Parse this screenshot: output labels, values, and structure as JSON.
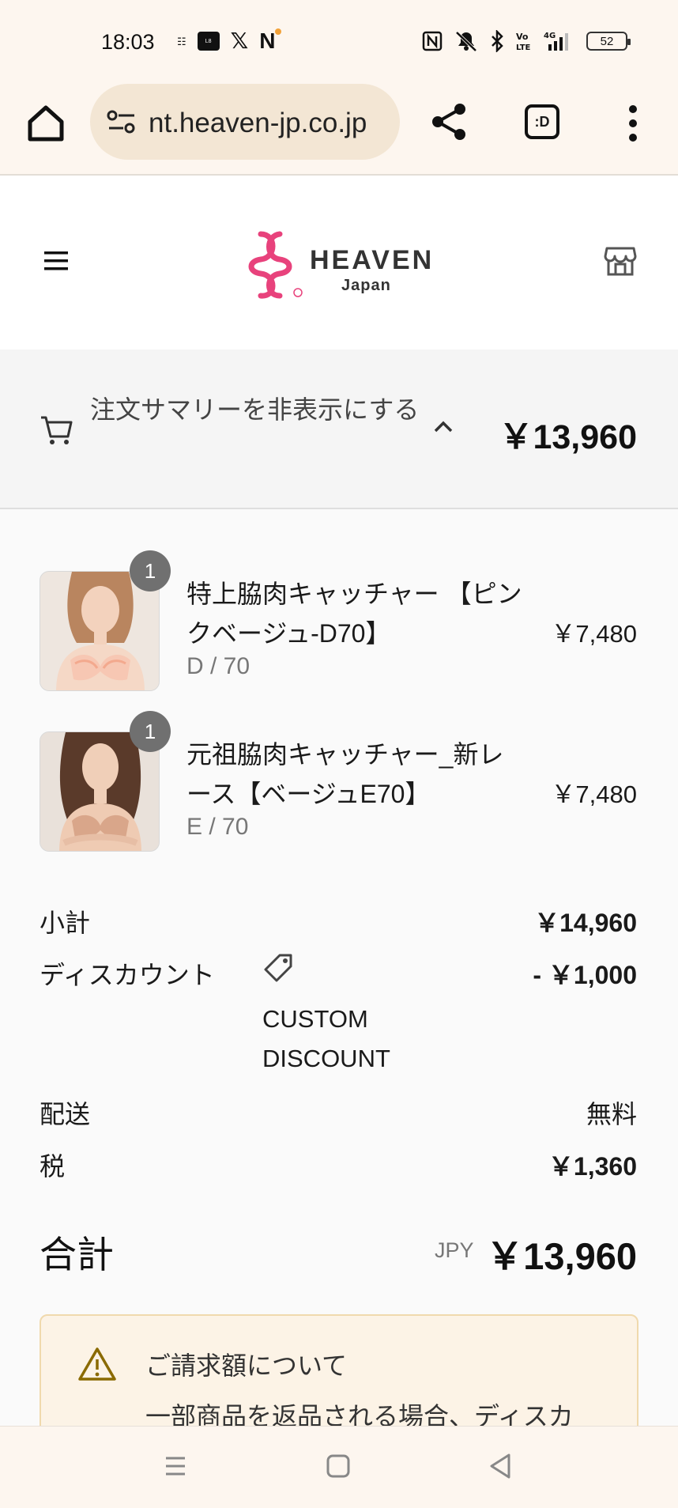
{
  "status_bar": {
    "time": "18:03",
    "left_icons": [
      "temu-icon",
      "lemon8-icon",
      "x-icon",
      "n-icon"
    ],
    "right_icons": [
      "nfc-icon",
      "mute-icon",
      "bluetooth-icon",
      "volte-icon",
      "signal-4g-icon"
    ],
    "battery": "52"
  },
  "browser": {
    "url": "nt.heaven-jp.co.jp",
    "tabs_label": ":D"
  },
  "site": {
    "brand": "HEAVEN",
    "brand_sub": "Japan",
    "brand_color": "#e8427c"
  },
  "summary_bar": {
    "toggle_label": "注文サマリーを非表示にする",
    "total": "￥13,960"
  },
  "items": [
    {
      "quantity": "1",
      "name": "特上脇肉キャッチャー 【ピンクベージュ-D70】",
      "variant": "D / 70",
      "price": "￥7,480"
    },
    {
      "quantity": "1",
      "name": "元祖脇肉キャッチャー_新レース【ベージュE70】",
      "variant": "E / 70",
      "price": "￥7,480"
    }
  ],
  "totals": {
    "subtotal_label": "小計",
    "subtotal_value": "￥14,960",
    "discount_label": "ディスカウント",
    "discount_code": "CUSTOM DISCOUNT",
    "discount_value": "- ￥1,000",
    "shipping_label": "配送",
    "shipping_value": "無料",
    "tax_label": "税",
    "tax_value": "￥1,360",
    "grand_label": "合計",
    "grand_currency": "JPY",
    "grand_value": "￥13,960"
  },
  "notice": {
    "title": "ご請求額について",
    "body": "一部商品を返品される場合、ディスカ"
  }
}
